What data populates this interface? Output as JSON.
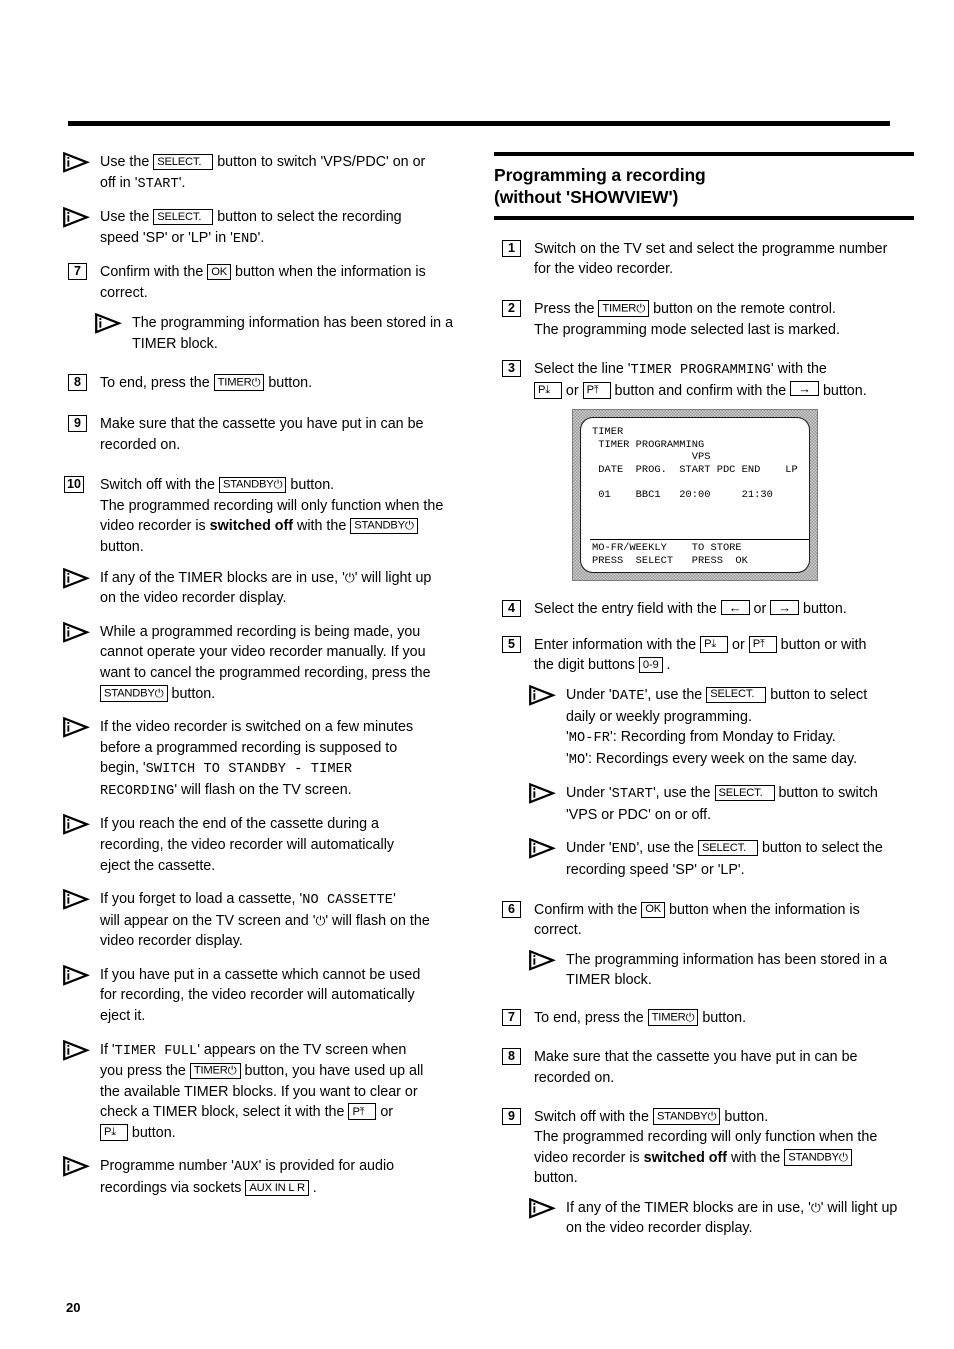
{
  "page": {
    "number": "20"
  },
  "left_column": {
    "notes_top": [
      {
        "id": "note-vps-pdc",
        "parts": [
          {
            "t": "text",
            "v": "Use the "
          },
          {
            "t": "key",
            "v": "SELECT."
          },
          {
            "t": "text",
            "v": " button to switch 'VPS/PDC' on or off in '"
          },
          {
            "t": "osd",
            "v": "START"
          },
          {
            "t": "text",
            "v": "'."
          }
        ],
        "plain": "Use the SELECT. button to switch 'VPS/PDC' on or off in 'START'."
      },
      {
        "id": "note-speed",
        "plain": "Use the SELECT. button to select the recording speed 'SP' or 'LP' in 'END'."
      }
    ],
    "steps": [
      {
        "num": "7",
        "plain": "Confirm with the OK button when the information is correct.",
        "notes": [
          {
            "plain": "The programming information has been stored in a TIMER block."
          }
        ]
      },
      {
        "num": "8",
        "plain": "To end, press the TIMER button."
      },
      {
        "num": "9",
        "plain": "Make sure that the cassette you have put in can be recorded on."
      },
      {
        "num": "10",
        "plain": "Switch off with the STANDBY button. The programmed recording will only function when the video recorder is switched off with the STANDBY button.",
        "notes": [
          {
            "plain": "If any of the TIMER blocks are in use, '⏻' will light up on the video recorder display."
          },
          {
            "plain": "While a programmed recording is being made, you cannot operate your video recorder manually. If you want to cancel the programmed recording, press the STANDBY button."
          },
          {
            "plain": "If the video recorder is switched on a few minutes before a programmed recording is supposed to begin, 'SWITCH TO STANDBY - TIMER RECORDING' will flash on the TV screen."
          },
          {
            "plain": "If you reach the end of the cassette during a recording, the video recorder will automatically eject the cassette."
          },
          {
            "plain": "If you forget to load a cassette, 'NO CASSETTE' will appear on the TV screen and '⏻' will flash on the video recorder display."
          },
          {
            "plain": "If you have put in a cassette which cannot be used for recording, the video recorder will automatically eject it."
          },
          {
            "plain": "If 'TIMER FULL' appears on the TV screen when you press the TIMER button, you have used up all the available TIMER blocks. If you want to clear or check a TIMER block, select it with the P↑ or P↓ button."
          },
          {
            "plain": "Programme number 'AUX' is provided for audio recordings via sockets AUX IN L R."
          }
        ]
      }
    ],
    "fragments": {
      "use_the": "Use the ",
      "button_to_switch_vps": " button to switch 'VPS/PDC' on or",
      "off_in": "off in '",
      "start": "START",
      "close_quote_period": "'.",
      "button_to_select_rec": " button to select the recording",
      "speed_sp_lp_in": "speed 'SP' or 'LP' in '",
      "end": "END",
      "confirm_with_the": "Confirm with the ",
      "button_when_info": " button when the information is",
      "correct": "correct.",
      "prog_info_stored_1": "The programming information has been stored in a",
      "prog_info_stored_2": "TIMER block.",
      "to_end_press_the": "To end, press the ",
      "button_period": " button.",
      "make_sure_1": "Make sure that the cassette you have put in can be",
      "make_sure_2": "recorded on.",
      "switch_off_with_the": "Switch off with the ",
      "prog_rec_only_1": "The programmed recording will only function when the",
      "prog_rec_only_2": "video recorder is ",
      "switched_off": "switched off",
      "with_the": " with the ",
      "button_word": "button.",
      "timer_blocks_1": "If any of the TIMER blocks are in use, '",
      "timer_blocks_2": "' will light up",
      "timer_blocks_3": "on the video recorder display.",
      "while_prog_1": "While a programmed recording is being made, you",
      "while_prog_2": "cannot operate your video recorder manually. If you",
      "while_prog_3": "want to cancel the programmed recording, press the",
      "if_switched_on_1": "If the video recorder is switched on a few minutes",
      "if_switched_on_2": "before a programmed recording is supposed to",
      "if_switched_on_3": "begin, '",
      "switch_to_standby": "SWITCH TO STANDBY - TIMER",
      "recording_osd": "RECORDING",
      "will_flash_tv": "' will flash on the TV screen.",
      "end_of_cassette_1": "If you reach the end of the cassette during a",
      "end_of_cassette_2": "recording, the video recorder will automatically",
      "end_of_cassette_3": "eject the cassette.",
      "forget_load_1": "If you forget to load a cassette, '",
      "no_cassette": "NO CASSETTE",
      "forget_load_2": "will appear on the TV screen and '",
      "forget_load_3": "' will flash on the",
      "forget_load_4": "video recorder display.",
      "cannot_be_used_1": "If you have put in a cassette which cannot be used",
      "cannot_be_used_2": "for recording, the video recorder will automatically",
      "cannot_be_used_3": "eject it.",
      "timer_full_1": "If '",
      "timer_full_osd": "TIMER FULL",
      "timer_full_2": "' appears on the TV screen when",
      "timer_full_3": "you press the ",
      "timer_full_4": " button, you have used up all",
      "timer_full_5": "the available TIMER blocks. If you want to clear or",
      "timer_full_6": "check a TIMER block, select it with the ",
      "or_word": " or",
      "aux_1": "Programme number '",
      "aux_osd": "AUX",
      "aux_2": "' is provided for audio",
      "aux_3": "recordings via sockets ",
      "aux_4": " ."
    }
  },
  "right_column": {
    "heading": {
      "line1": "Programming a recording",
      "line2_pre": "(without '",
      "line2_osd": "SHOWVIEW",
      "line2_post": "')"
    },
    "steps": [
      {
        "num": "1",
        "plain": "Switch on the TV set and select the programme number for the video recorder."
      },
      {
        "num": "2",
        "plain": "Press the TIMER button on the remote control. The programming mode selected last is marked."
      },
      {
        "num": "3",
        "plain": "Select the line 'TIMER PROGRAMMING' with the P↓ or P↑ button and confirm with the → button."
      },
      {
        "num": "4",
        "plain": "Select the entry field with the ← or → button."
      },
      {
        "num": "5",
        "plain": "Enter information with the P↓ or P↑ button or with the digit buttons 0-9."
      },
      {
        "num": "6",
        "plain": "Confirm with the OK button when the information is correct."
      },
      {
        "num": "7",
        "plain": "To end, press the TIMER button."
      },
      {
        "num": "8",
        "plain": "Make sure that the cassette you have put in can be recorded on."
      },
      {
        "num": "9",
        "plain": "Switch off with the STANDBY button. The programmed recording will only function when the video recorder is switched off with the STANDBY button."
      }
    ],
    "fragments": {
      "s1_l1": "Switch on the TV set and select the programme number",
      "s1_l2": "for the video recorder.",
      "s2_l1a": "Press the ",
      "s2_l1b": " button on the remote control.",
      "s2_l2": "The programming mode selected last is marked.",
      "s3_l1a": "Select the line '",
      "s3_osd": "TIMER PROGRAMMING",
      "s3_l1b": "' with the",
      "s3_l2a": " or ",
      "s3_l2b": " button and confirm with the ",
      "s3_l2c": " button.",
      "s4_a": "Select the entry field with the ",
      "s4_b": " or ",
      "s4_c": " button.",
      "s5_a": "Enter information with the ",
      "s5_b": " or ",
      "s5_c": " button or with",
      "s5_d": "the digit buttons ",
      "s5_e": " .",
      "n_date_1": "Under '",
      "n_date_osd": "DATE",
      "n_date_2": "', use the ",
      "n_date_3": " button to select",
      "n_date_4": "daily or weekly programming.",
      "n_date_5a": "MO-FR",
      "n_date_5b": "': Recording from Monday to Friday.",
      "n_date_6a": "MO",
      "n_date_6b": "': Recordings every week on the same day.",
      "n_start_1": "Under '",
      "n_start_osd": "START",
      "n_start_2": "', use the ",
      "n_start_3": " button to switch",
      "n_start_4": "'VPS or PDC' on or off.",
      "n_end_1": "Under '",
      "n_end_osd": "END",
      "n_end_2": "', use the ",
      "n_end_3": " button to select the",
      "n_end_4": "recording speed 'SP' or 'LP'.",
      "s6_a": "Confirm with the ",
      "s6_b": " button when the information is",
      "s6_c": "correct.",
      "s6_n1": "The programming information has been stored in a",
      "s6_n2": "TIMER block.",
      "s7_a": "To end, press the ",
      "s7_b": " button.",
      "s8_a": "Make sure that the cassette you have put in can be",
      "s8_b": "recorded on.",
      "s9_a": "Switch off with the ",
      "s9_b": " button.",
      "s9_c": "The programmed recording will only function when the",
      "s9_d": "video recorder is ",
      "s9_e": "switched off",
      "s9_f": " with the ",
      "s9_g": "button.",
      "s9_n1": "If any of the TIMER blocks are in use, '",
      "s9_n2": "' will light up",
      "s9_n3": "on the video recorder display."
    },
    "tv_screen": {
      "name": "timer-programming-osd",
      "body": "TIMER\n TIMER PROGRAMMING\n                VPS\n DATE  PROG.  START PDC END    LP\n\n 01    BBC1   20:00     21:30",
      "footer": "MO-FR/WEEKLY    TO STORE\nPRESS  SELECT   PRESS  OK",
      "columns": [
        "DATE",
        "PROG.",
        "START",
        "VPS PDC",
        "END",
        "LP"
      ],
      "rows": [
        [
          "01",
          "BBC1",
          "20:00",
          "",
          "21:30",
          ""
        ]
      ]
    }
  },
  "keys": {
    "select": "SELECT.",
    "ok": "OK",
    "timer": "TIMER",
    "standby": "STANDBY",
    "p_down": "P",
    "p_up": "P",
    "digits": "0-9",
    "aux_in": "AUX IN L R",
    "arrow_right": "→",
    "arrow_left": "←",
    "arrow_up": "↑",
    "arrow_down": "↓",
    "power_glyph": "⏻"
  }
}
